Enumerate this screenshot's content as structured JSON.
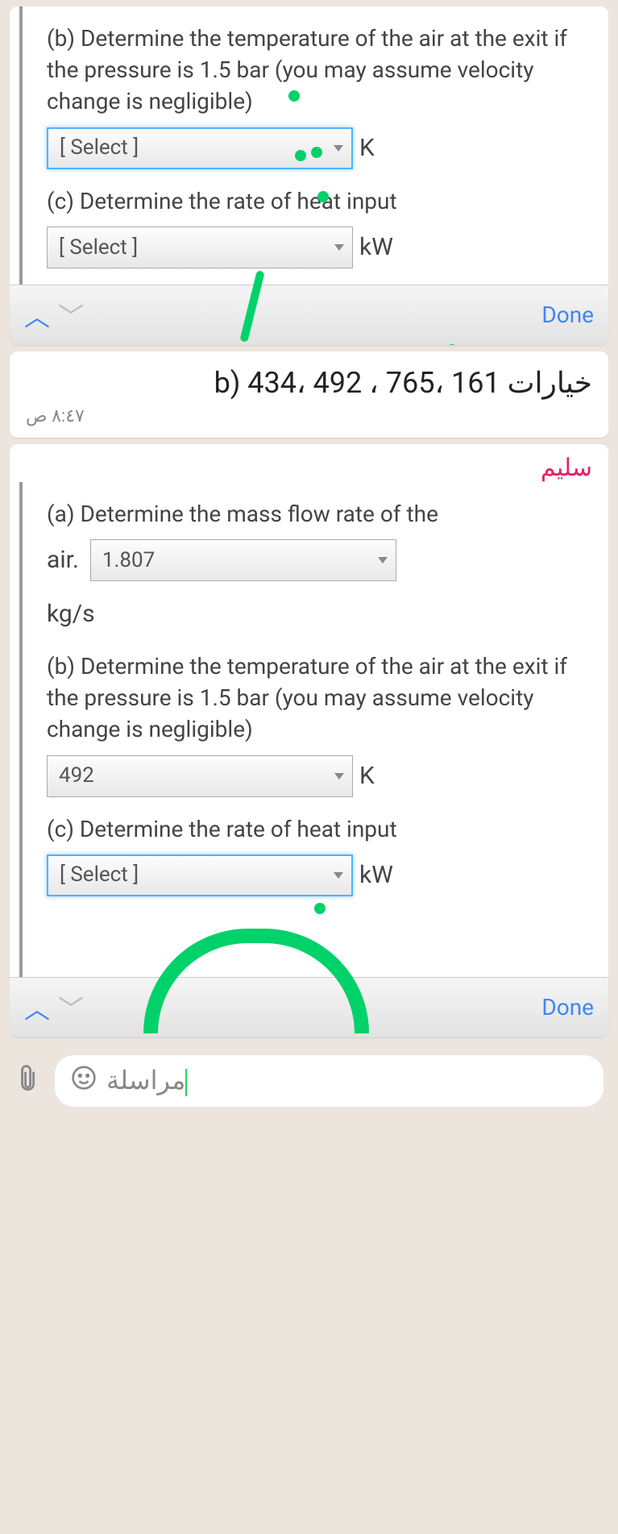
{
  "msg1": {
    "question_b": "(b) Determine the temperature of the air at the exit if the pressure is 1.5 bar (you may assume velocity change is negligible)",
    "select_b_value": "[ Select ]",
    "unit_b": "K",
    "question_c": "(c) Determine the rate of heat input",
    "select_c_value": "[ Select ]",
    "unit_c": "kW",
    "done_label": "Done"
  },
  "msg2": {
    "text_rtl": "خيارات 161 ،765 ، 492 ،434 (b",
    "timestamp": "٨:٤٧ ص"
  },
  "msg3": {
    "sender": "سليم",
    "question_a": "(a) Determine the mass flow rate of the",
    "air_label": "air.",
    "select_a_value": "1.807",
    "unit_a": "kg/s",
    "question_b": "(b) Determine the temperature of the air at the exit if the pressure is 1.5 bar (you may assume velocity change is negligible)",
    "select_b_value": "492",
    "unit_b": "K",
    "question_c": "(c) Determine the rate of heat input",
    "select_c_value": "[ Select ]",
    "unit_c": "kW",
    "done_label": "Done"
  },
  "input": {
    "placeholder": "مراسلة"
  }
}
